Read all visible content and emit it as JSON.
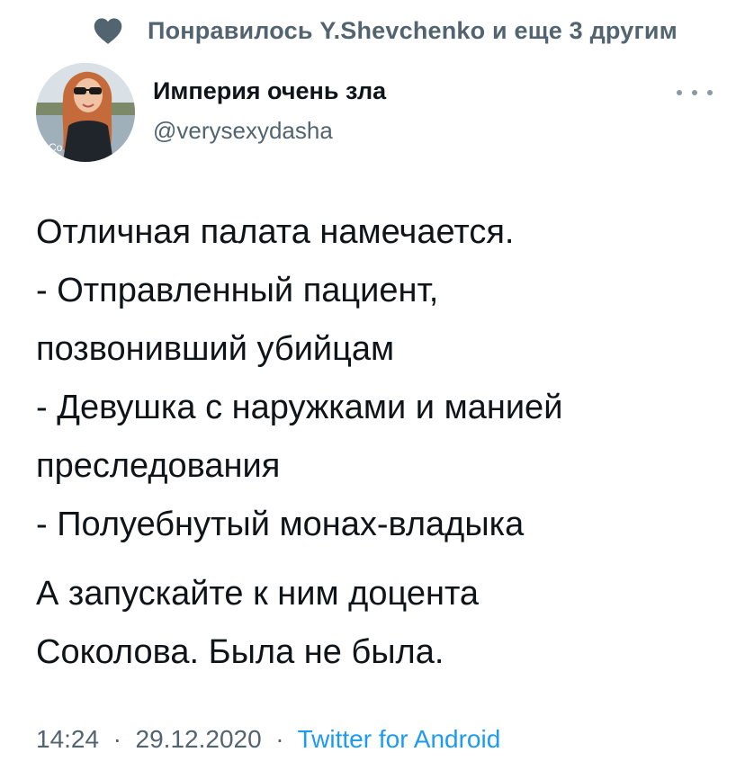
{
  "social_context": {
    "icon": "heart-icon",
    "text": "Понравилось Y.Shevchenko и еще 3 другим"
  },
  "author": {
    "display_name": "Империя очень зла",
    "handle": "@verysexydasha",
    "avatar_overlay_text": "Co"
  },
  "tweet": {
    "lines_paragraph1": [
      "Отличная палата намечается.",
      "- Отправленный пациент,",
      "позвонивший убийцам",
      "- Девушка с наружками и манией",
      "преследования",
      "- Полуебнутый монах-владыка"
    ],
    "lines_paragraph2": [
      "А запускайте к ним доцента",
      "Соколова. Была не была."
    ]
  },
  "meta": {
    "time": "14:24",
    "separator": "·",
    "date": "29.12.2020",
    "source": "Twitter for Android"
  },
  "colors": {
    "text_primary": "#0f1419",
    "text_secondary": "#536471",
    "link": "#1d9bf0"
  }
}
